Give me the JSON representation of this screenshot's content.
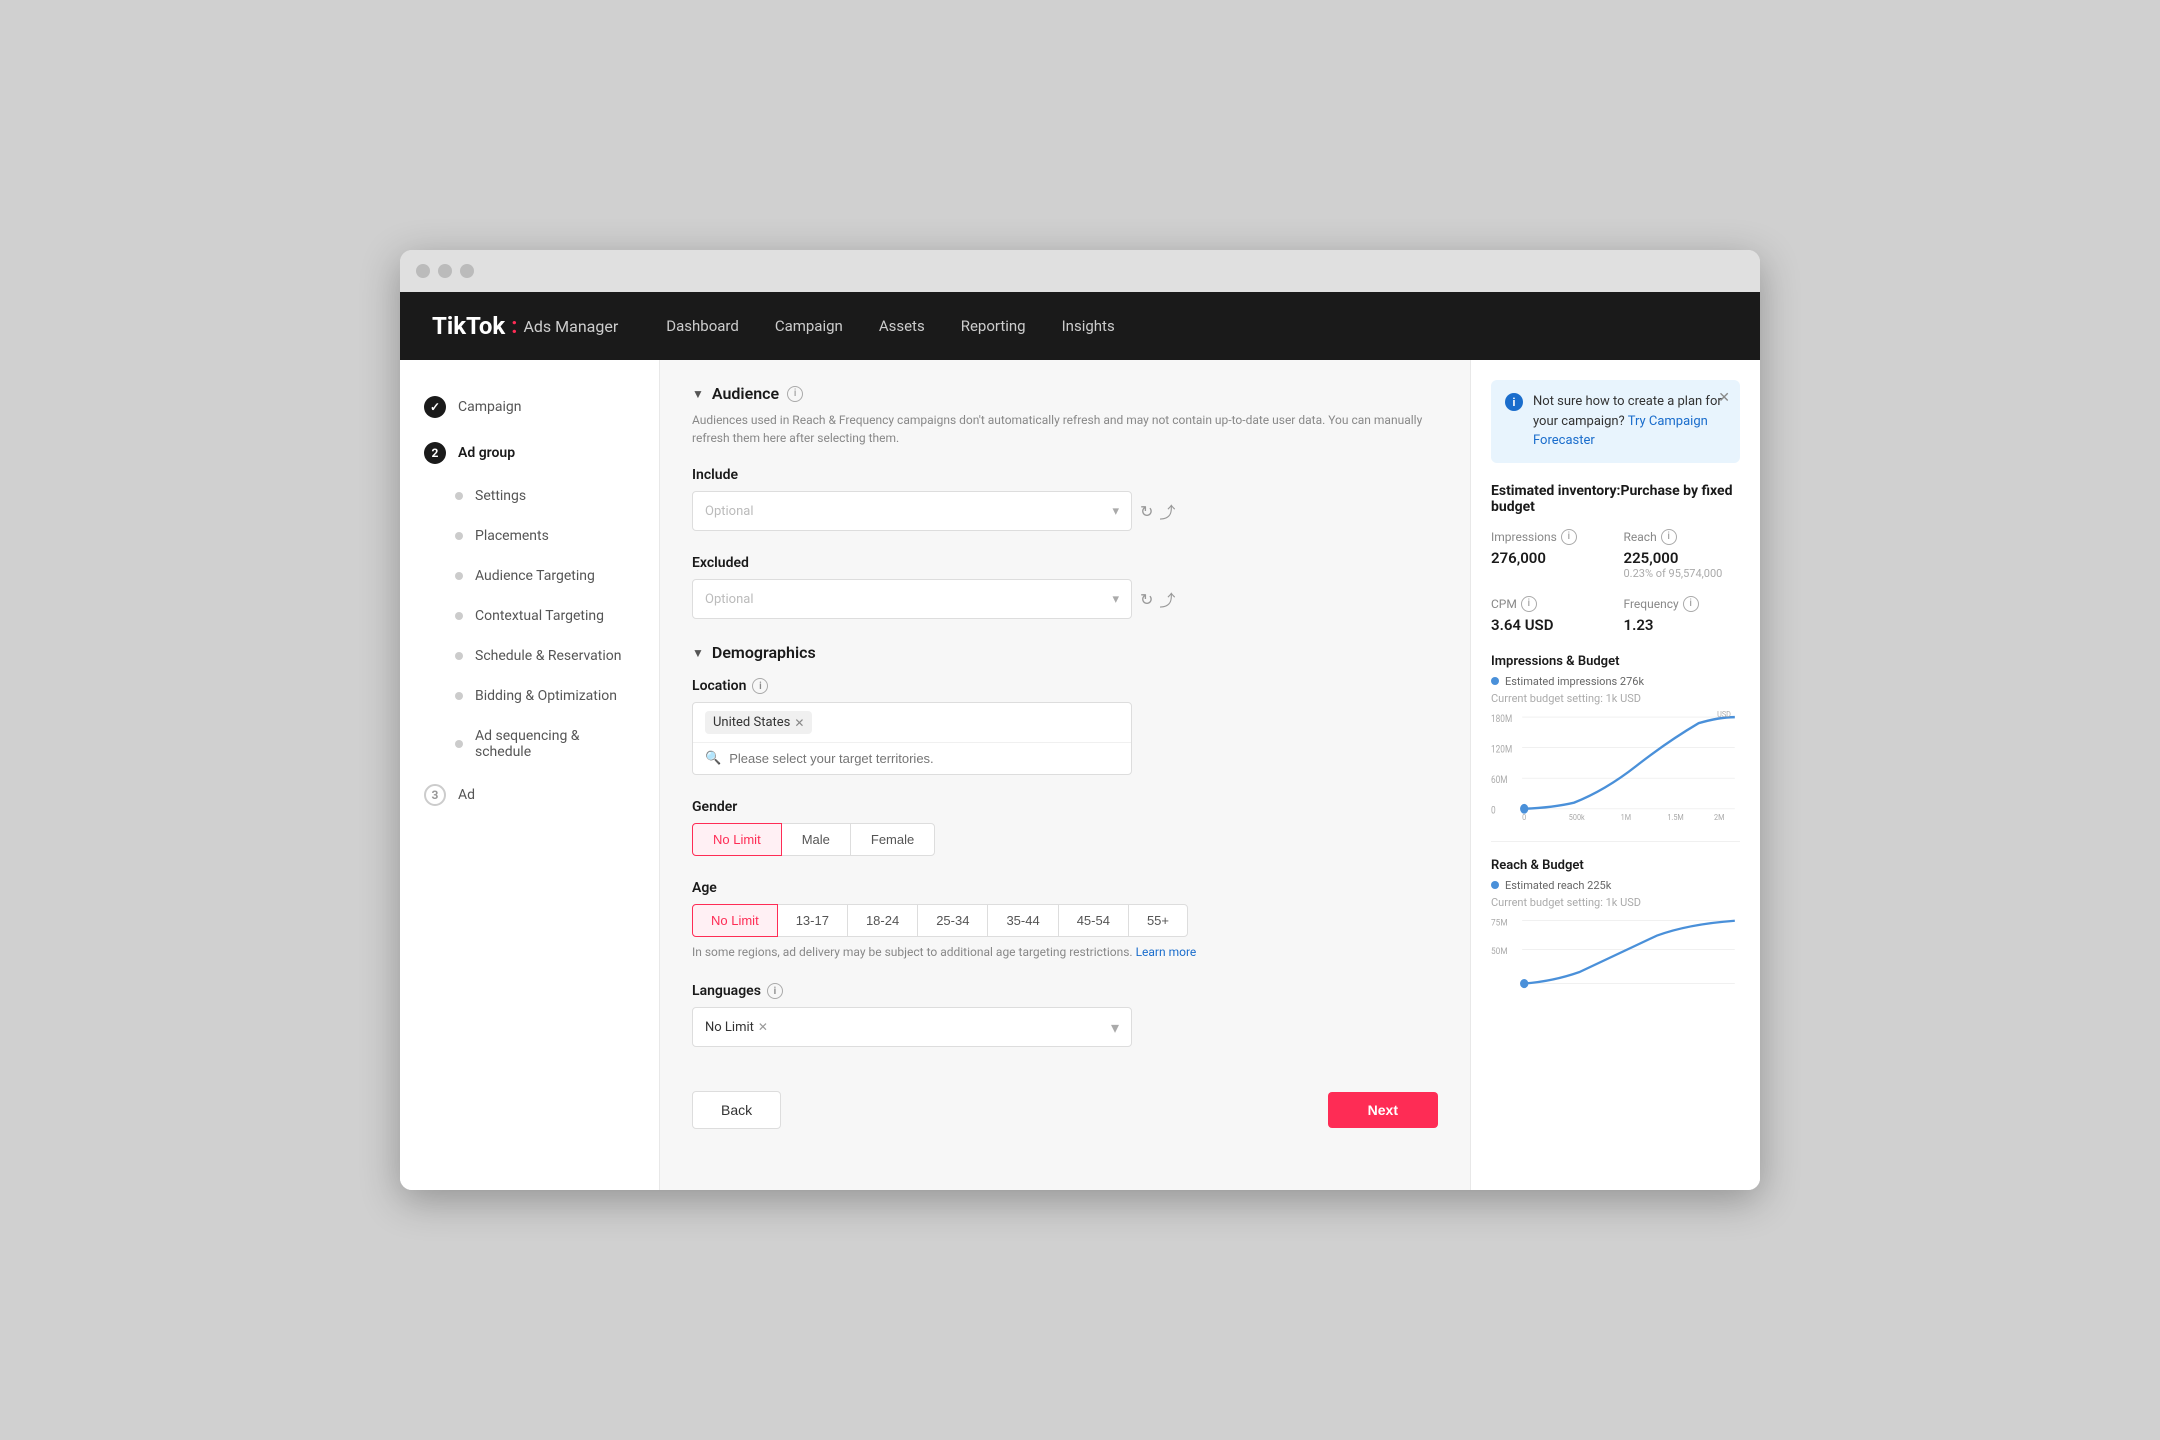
{
  "browser": {
    "dots": [
      "dot1",
      "dot2",
      "dot3"
    ]
  },
  "topnav": {
    "logo": {
      "brand": "TikTok",
      "colon": ":",
      "sub": "Ads Manager"
    },
    "links": [
      "Dashboard",
      "Campaign",
      "Assets",
      "Reporting",
      "Insights"
    ]
  },
  "sidebar": {
    "steps": [
      {
        "id": "campaign",
        "label": "Campaign",
        "type": "done",
        "icon": "✓"
      },
      {
        "id": "adgroup",
        "label": "Ad group",
        "type": "active",
        "icon": "2"
      },
      {
        "id": "ad",
        "label": "Ad",
        "type": "pending",
        "icon": "3"
      }
    ],
    "sub_items": [
      {
        "id": "settings",
        "label": "Settings"
      },
      {
        "id": "placements",
        "label": "Placements"
      },
      {
        "id": "audience-targeting",
        "label": "Audience Targeting"
      },
      {
        "id": "contextual-targeting",
        "label": "Contextual Targeting"
      },
      {
        "id": "schedule-reservation",
        "label": "Schedule & Reservation"
      },
      {
        "id": "bidding-optimization",
        "label": "Bidding & Optimization"
      },
      {
        "id": "ad-sequencing",
        "label": "Ad sequencing & schedule"
      }
    ]
  },
  "audience_section": {
    "title": "Audience",
    "desc": "Audiences used in Reach & Frequency campaigns don't automatically refresh and may not contain up-to-date user data. You can manually refresh them here after selecting them.",
    "include_label": "Include",
    "include_placeholder": "Optional",
    "excluded_label": "Excluded",
    "excluded_placeholder": "Optional"
  },
  "demographics_section": {
    "title": "Demographics",
    "location_label": "Location",
    "location_tag": "United States",
    "location_search_placeholder": "Please select your target territories.",
    "gender_label": "Gender",
    "gender_options": [
      "No Limit",
      "Male",
      "Female"
    ],
    "gender_selected": "No Limit",
    "age_label": "Age",
    "age_options": [
      "No Limit",
      "13-17",
      "18-24",
      "25-34",
      "35-44",
      "45-54",
      "55+"
    ],
    "age_selected": "No Limit",
    "age_note": "In some regions, ad delivery may be subject to additional age targeting restrictions.",
    "age_note_link": "Learn more",
    "languages_label": "Languages",
    "languages_tag": "No Limit"
  },
  "footer": {
    "back_label": "Back",
    "next_label": "Next"
  },
  "right_panel": {
    "info_banner": {
      "text": "Not sure how to create a plan for your campaign?",
      "link_text": "Try Campaign Forecaster"
    },
    "estimated_title": "Estimated inventory:Purchase by fixed budget",
    "impressions_label": "Impressions",
    "impressions_value": "276,000",
    "reach_label": "Reach",
    "reach_value": "225,000",
    "reach_sub": "0.23% of 95,574,000",
    "cpm_label": "CPM",
    "cpm_value": "3.64 USD",
    "frequency_label": "Frequency",
    "frequency_value": "1.23",
    "impressions_budget_title": "Impressions & Budget",
    "impressions_budget_legend": "Estimated impressions 276k",
    "impressions_budget_sub": "Current budget setting: 1k USD",
    "chart1_y_labels": [
      "180M",
      "120M",
      "60M",
      "0"
    ],
    "chart1_x_labels": [
      "0",
      "500k",
      "1M",
      "1.5M",
      "2M"
    ],
    "chart1_x_unit": "USD",
    "reach_budget_title": "Reach & Budget",
    "reach_budget_legend": "Estimated reach 225k",
    "reach_budget_sub": "Current budget setting: 1k USD",
    "chart2_y_labels": [
      "75M",
      "50M"
    ]
  }
}
